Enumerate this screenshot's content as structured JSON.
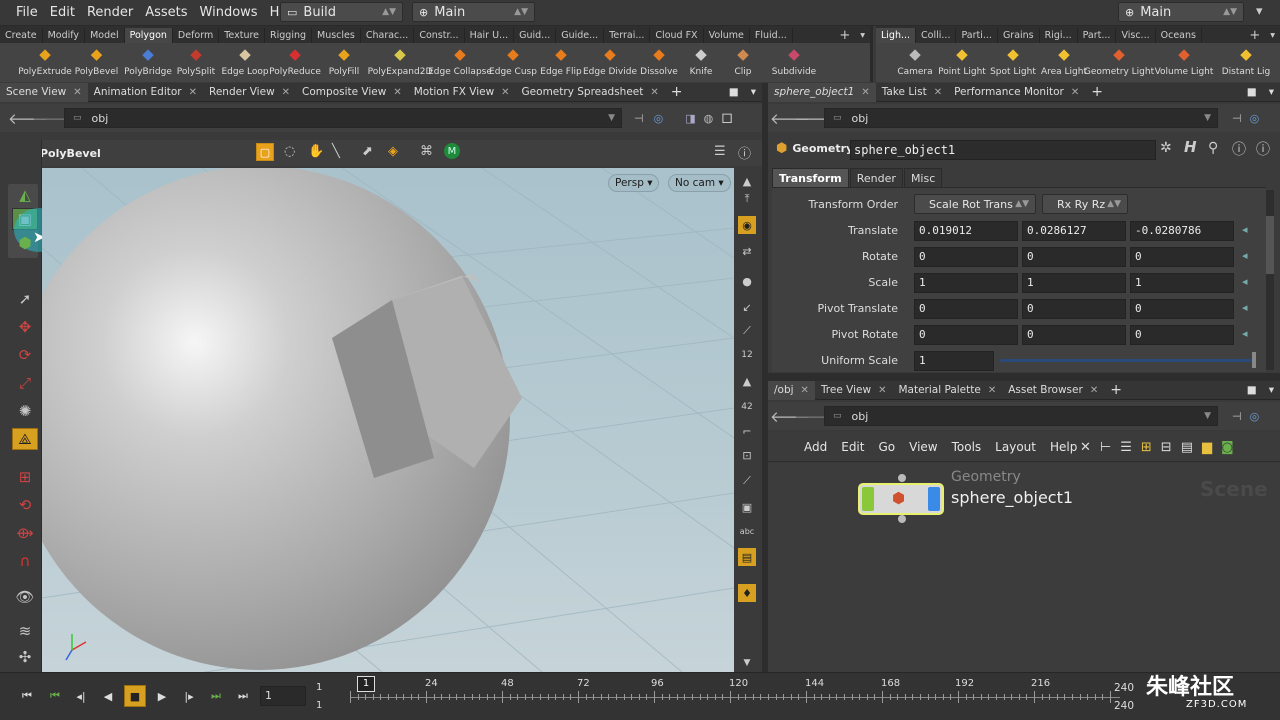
{
  "menubar": {
    "items": [
      "File",
      "Edit",
      "Render",
      "Assets",
      "Windows",
      "Help"
    ],
    "desktop": "Build",
    "main_label": "Main",
    "right_main": "Main"
  },
  "shelf_left": {
    "tabs": [
      "Create",
      "Modify",
      "Model",
      "Polygon",
      "Deform",
      "Texture",
      "Rigging",
      "Muscles",
      "Charac...",
      "Constr...",
      "Hair U...",
      "Guid...",
      "Guide...",
      "Terrai...",
      "Cloud FX",
      "Volume",
      "Fluid..."
    ],
    "active_tab": "Polygon",
    "tools": [
      {
        "label": "PolyExtrude",
        "icon": "polyextrude-icon",
        "color": "#e8a21c"
      },
      {
        "label": "PolyBevel",
        "icon": "polybevel-icon",
        "color": "#e8a21c"
      },
      {
        "label": "PolyBridge",
        "icon": "polybridge-icon",
        "color": "#4a7ed6"
      },
      {
        "label": "PolySplit",
        "icon": "polysplit-icon",
        "color": "#c43a2c"
      },
      {
        "label": "Edge Loop",
        "icon": "edge-loop-icon",
        "color": "#d9c6a0"
      },
      {
        "label": "PolyReduce",
        "icon": "polyreduce-icon",
        "color": "#d83030"
      },
      {
        "label": "PolyFill",
        "icon": "polyfill-icon",
        "color": "#e8a21c"
      },
      {
        "label": "PolyExpand2D",
        "icon": "polyexpand2d-icon",
        "color": "#d8c84a"
      },
      {
        "label": "Edge Collapse",
        "icon": "edge-collapse-icon",
        "color": "#e87c1c"
      },
      {
        "label": "Edge Cusp",
        "icon": "edge-cusp-icon",
        "color": "#e87c1c"
      },
      {
        "label": "Edge Flip",
        "icon": "edge-flip-icon",
        "color": "#e87c1c"
      },
      {
        "label": "Edge Divide",
        "icon": "edge-divide-icon",
        "color": "#e87c1c"
      },
      {
        "label": "Dissolve",
        "icon": "dissolve-icon",
        "color": "#e87c1c"
      },
      {
        "label": "Knife",
        "icon": "knife-icon",
        "color": "#cccccc"
      },
      {
        "label": "Clip",
        "icon": "clip-icon",
        "color": "#d08a50"
      },
      {
        "label": "Subdivide",
        "icon": "subdivide-icon",
        "color": "#c84a6a"
      }
    ]
  },
  "shelf_right": {
    "tabs": [
      "Ligh...",
      "Colli...",
      "Parti...",
      "Grains",
      "Rigi...",
      "Part...",
      "Visc...",
      "Oceans"
    ],
    "active_tab": "Ligh...",
    "tools": [
      {
        "label": "Camera",
        "icon": "camera-icon",
        "color": "#bbbbbb"
      },
      {
        "label": "Point Light",
        "icon": "point-light-icon",
        "color": "#f0c030"
      },
      {
        "label": "Spot Light",
        "icon": "spot-light-icon",
        "color": "#f0c030"
      },
      {
        "label": "Area Light",
        "icon": "area-light-icon",
        "color": "#f0c030"
      },
      {
        "label": "Geometry Light",
        "icon": "geometry-light-icon",
        "color": "#e06030"
      },
      {
        "label": "Volume Light",
        "icon": "volume-light-icon",
        "color": "#e06030"
      },
      {
        "label": "Distant Lig",
        "icon": "distant-light-icon",
        "color": "#f0c030"
      }
    ]
  },
  "left_pane": {
    "tabs": [
      "Scene View",
      "Animation Editor",
      "Render View",
      "Composite View",
      "Motion FX View",
      "Geometry Spreadsheet"
    ],
    "active_tab": "Scene View",
    "path": "obj",
    "tool_name": "PolyBevel",
    "persp": "Persp",
    "cam": "No cam"
  },
  "right_top_pane": {
    "tabs": [
      "sphere_object1",
      "Take List",
      "Performance Monitor"
    ],
    "path": "obj",
    "node_type": "Geometry",
    "node_name": "sphere_object1",
    "param_tabs": [
      "Transform",
      "Render",
      "Misc"
    ],
    "active_param_tab": "Transform",
    "transform_order_label": "Transform Order",
    "transform_order": "Scale Rot Trans",
    "rotate_order": "Rx Ry Rz",
    "params": [
      {
        "label": "Translate",
        "values": [
          "0.019012",
          "0.0286127",
          "-0.0280786"
        ]
      },
      {
        "label": "Rotate",
        "values": [
          "0",
          "0",
          "0"
        ]
      },
      {
        "label": "Scale",
        "values": [
          "1",
          "1",
          "1"
        ]
      },
      {
        "label": "Pivot Translate",
        "values": [
          "0",
          "0",
          "0"
        ]
      },
      {
        "label": "Pivot Rotate",
        "values": [
          "0",
          "0",
          "0"
        ]
      }
    ],
    "uniform_scale_label": "Uniform Scale",
    "uniform_scale": "1"
  },
  "right_bottom_pane": {
    "tabs": [
      "/obj",
      "Tree View",
      "Material Palette",
      "Asset Browser"
    ],
    "path": "obj",
    "menu": [
      "Add",
      "Edit",
      "Go",
      "View",
      "Tools",
      "Layout",
      "Help"
    ],
    "node_type": "Geometry",
    "node_name": "sphere_object1",
    "watermark": "Scene"
  },
  "timeline": {
    "current_frame": "1",
    "start_frame": "1",
    "start_frame2": "1",
    "marker": "1",
    "ticks": [
      "24",
      "48",
      "72",
      "96",
      "120",
      "144",
      "168",
      "192",
      "216"
    ],
    "end_frame": "240",
    "end_frame2": "240"
  },
  "watermark": {
    "brand": "朱峰社区",
    "url": "ZF3D.COM"
  }
}
